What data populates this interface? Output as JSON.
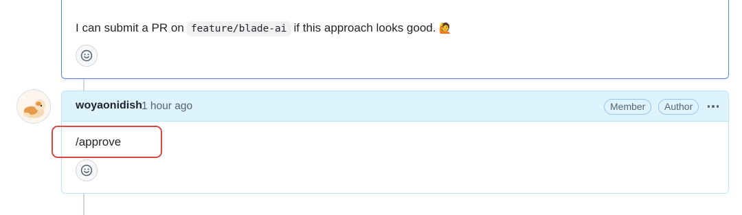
{
  "previous_comment": {
    "text_before": "I can submit a PR on",
    "branch_code": "feature/blade-ai",
    "text_after": "if this approach looks good.",
    "emoji": "🙋"
  },
  "comment": {
    "author": "woyaonidish",
    "timestamp": "1 hour ago",
    "badges": [
      "Member",
      "Author"
    ],
    "body": "/approve"
  },
  "icons": {
    "reaction": "smiley-icon",
    "menu": "kebab-horizontal-icon"
  },
  "colors": {
    "header_bg": "#ddf4ff",
    "focus_border": "#4f86e8",
    "highlight": "#d9453f"
  }
}
